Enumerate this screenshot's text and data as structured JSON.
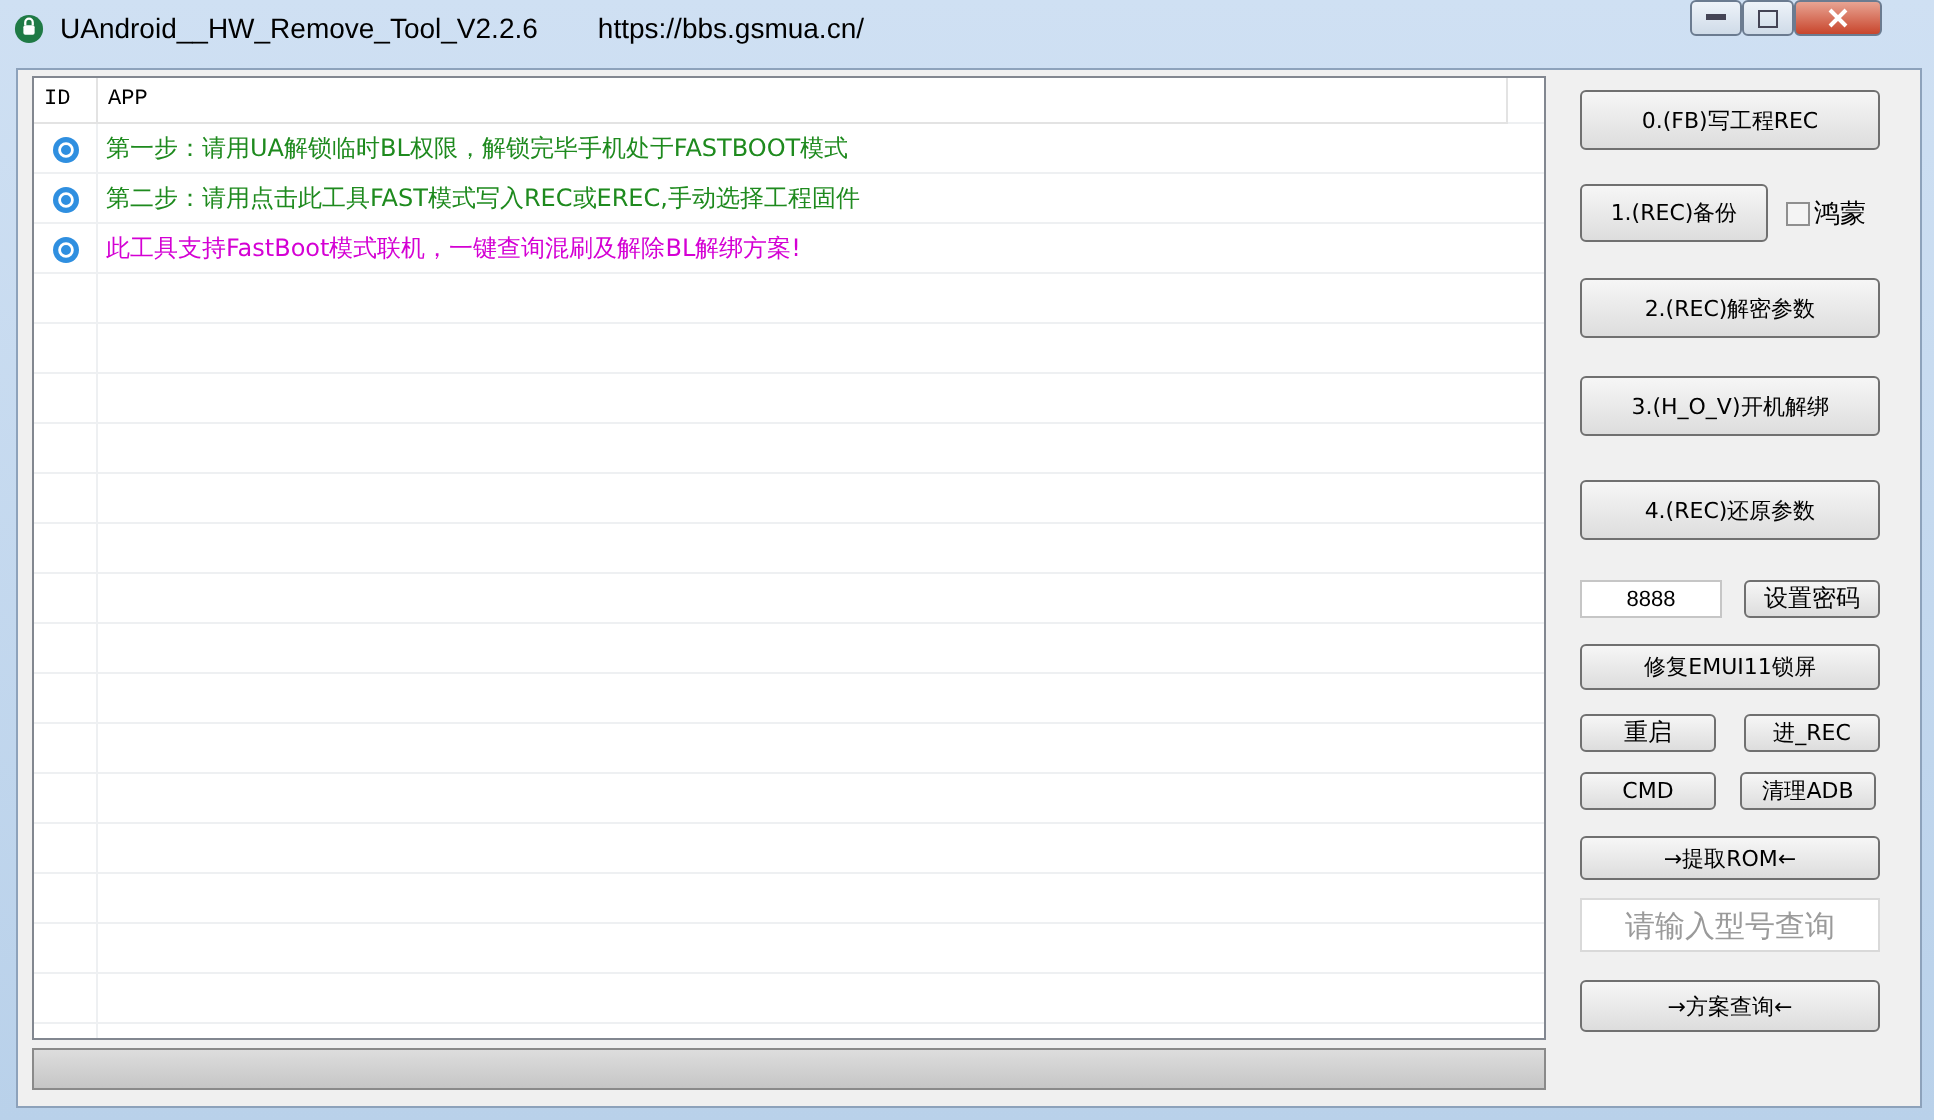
{
  "window": {
    "title": "UAndroid__HW_Remove_Tool_V2.2.6",
    "url": "https://bbs.gsmua.cn/"
  },
  "table": {
    "columns": [
      "ID",
      "APP"
    ],
    "rows": [
      {
        "text": "第一步：请用UA解锁临时BL权限，解锁完毕手机处于FASTBOOT模式",
        "color": "#1e8a1e"
      },
      {
        "text": "第二步：请用点击此工具FAST模式写入REC或EREC,手动选择工程固件",
        "color": "#1e8a1e"
      },
      {
        "text": "此工具支持FastBoot模式联机，一键查询混刷及解除BL解绑方案!",
        "color": "#d400d4"
      }
    ]
  },
  "panel": {
    "write_rec": "0.(FB)写工程REC",
    "backup": "1.(REC)备份",
    "harmony": {
      "label": "鸿蒙",
      "checked": false
    },
    "decrypt": "2.(REC)解密参数",
    "unbind": "3.(H_O_V)开机解绑",
    "restore": "4.(REC)还原参数",
    "password": {
      "value": "8888",
      "button": "设置密码"
    },
    "fix_lock": "修复EMUI11锁屏",
    "reboot": "重启",
    "enter_rec": "进_REC",
    "cmd": "CMD",
    "clean_adb": "清理ADB",
    "extract_rom": "→提取ROM←",
    "model_search": {
      "placeholder": "请输入型号查询"
    },
    "scheme_query": "→方案查询←"
  },
  "progress": {
    "level": 0
  }
}
